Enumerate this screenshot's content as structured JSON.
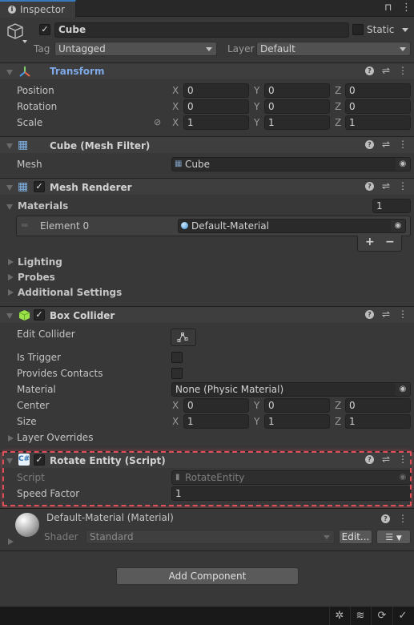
{
  "window": {
    "tab_label": "Inspector",
    "tab_icon": "info-icon"
  },
  "gameobject": {
    "active": true,
    "name": "Cube",
    "static_label": "Static",
    "static_checked": false,
    "tag_label": "Tag",
    "tag_value": "Untagged",
    "layer_label": "Layer",
    "layer_value": "Default"
  },
  "components": {
    "transform": {
      "title": "Transform",
      "rows": [
        {
          "label": "Position",
          "x": "0",
          "y": "0",
          "z": "0"
        },
        {
          "label": "Rotation",
          "x": "0",
          "y": "0",
          "z": "0"
        },
        {
          "label": "Scale",
          "x": "1",
          "y": "1",
          "z": "1"
        }
      ]
    },
    "mesh_filter": {
      "title": "Cube (Mesh Filter)",
      "mesh_label": "Mesh",
      "mesh_value": "Cube"
    },
    "mesh_renderer": {
      "title": "Mesh Renderer",
      "enabled": true,
      "materials_label": "Materials",
      "materials_count": "1",
      "elements": [
        {
          "label": "Element 0",
          "value": "Default-Material"
        }
      ],
      "add_label": "+",
      "remove_label": "−",
      "foldouts": [
        "Lighting",
        "Probes",
        "Additional Settings"
      ]
    },
    "box_collider": {
      "title": "Box Collider",
      "enabled": true,
      "edit_collider_label": "Edit Collider",
      "is_trigger_label": "Is Trigger",
      "is_trigger": false,
      "provides_contacts_label": "Provides Contacts",
      "provides_contacts": false,
      "material_label": "Material",
      "material_value": "None (Physic Material)",
      "center": {
        "label": "Center",
        "x": "0",
        "y": "0",
        "z": "0"
      },
      "size": {
        "label": "Size",
        "x": "1",
        "y": "1",
        "z": "1"
      },
      "layer_overrides_label": "Layer Overrides"
    },
    "rotate_entity": {
      "title": "Rotate Entity (Script)",
      "enabled": true,
      "script_label": "Script",
      "script_value": "RotateEntity",
      "speed_label": "Speed Factor",
      "speed_value": "1"
    },
    "material": {
      "title": "Default-Material (Material)",
      "shader_label": "Shader",
      "shader_value": "Standard",
      "edit_label": "Edit..."
    }
  },
  "axis_labels": {
    "x": "X",
    "y": "Y",
    "z": "Z"
  },
  "add_component_label": "Add Component",
  "colors": {
    "highlight": "#e0505a",
    "transform_title": "#7fa9e6",
    "accent_tab": "#3a79bb"
  }
}
